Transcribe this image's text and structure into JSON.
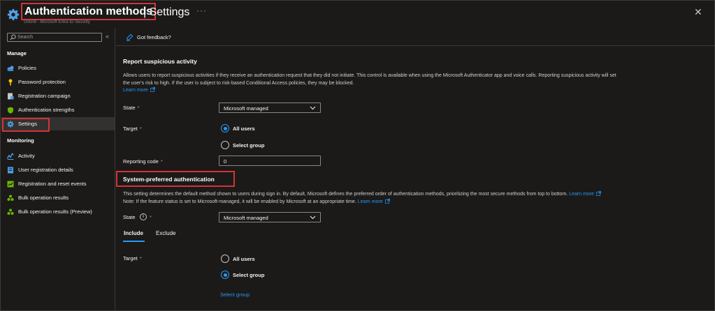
{
  "header": {
    "title": "Authentication methods",
    "separator_title": "| Settings",
    "subtitle": "Orlon8 - Microsoft Entra ID Security",
    "more": "···",
    "close": "✕"
  },
  "sidebar": {
    "search_placeholder": "Search",
    "collapse": "«",
    "sections": {
      "manage": "Manage",
      "monitoring": "Monitoring"
    },
    "manage_items": [
      {
        "label": "Policies",
        "icon": "policies-icon"
      },
      {
        "label": "Password protection",
        "icon": "key-icon"
      },
      {
        "label": "Registration campaign",
        "icon": "registration-icon"
      },
      {
        "label": "Authentication strengths",
        "icon": "shield-icon"
      },
      {
        "label": "Settings",
        "icon": "gear-icon",
        "selected": true
      }
    ],
    "monitoring_items": [
      {
        "label": "Activity",
        "icon": "activity-icon"
      },
      {
        "label": "User registration details",
        "icon": "user-details-icon"
      },
      {
        "label": "Registration and reset events",
        "icon": "events-icon"
      },
      {
        "label": "Bulk operation results",
        "icon": "bulk-icon"
      },
      {
        "label": "Bulk operation results (Preview)",
        "icon": "bulk-icon"
      }
    ]
  },
  "commandbar": {
    "feedback": "Got feedback?"
  },
  "report": {
    "heading": "Report suspicious activity",
    "desc_line1": "Allows users to report suspicious activities if they receive an authentication request that they did not initiate. This control is available when using the Microsoft Authenticator app and voice calls. Reporting suspicious activity will set",
    "desc_line2": "the user's risk to high. If the user is subject to risk-based Conditional Access policies, they may be blocked.",
    "learn_more": "Learn more",
    "state_label": "State",
    "state_value": "Microsoft managed",
    "target_label": "Target",
    "radio_all_users": "All users",
    "radio_select_group": "Select group",
    "reporting_code_label": "Reporting code",
    "reporting_code_value": "0",
    "required": "*"
  },
  "system_preferred": {
    "heading": "System-preferred authentication",
    "desc_line1": "This setting determines the default method shown to users during sign in. By default, Microsoft defines the preferred order of authentication methods, prioritizing the most secure methods from top to bottom.",
    "learn_more_1": "Learn more",
    "desc_line2": "Note: If the feature status is set to Microsoft-managed, it will be enabled by Microsoft at an appropriate time.",
    "learn_more_2": "Learn more",
    "state_label": "State",
    "info": "i",
    "state_value": "Microsoft managed",
    "tabs": [
      {
        "label": "Include",
        "active": true
      },
      {
        "label": "Exclude",
        "active": false
      }
    ],
    "target_label": "Target",
    "radio_all_users": "All users",
    "radio_select_group": "Select group",
    "select_group_link": "Select group",
    "required": "*"
  },
  "colors": {
    "background": "#1b1a19",
    "accent": "#2899f5",
    "highlight_border": "#d13438",
    "required": "#f1707b"
  }
}
